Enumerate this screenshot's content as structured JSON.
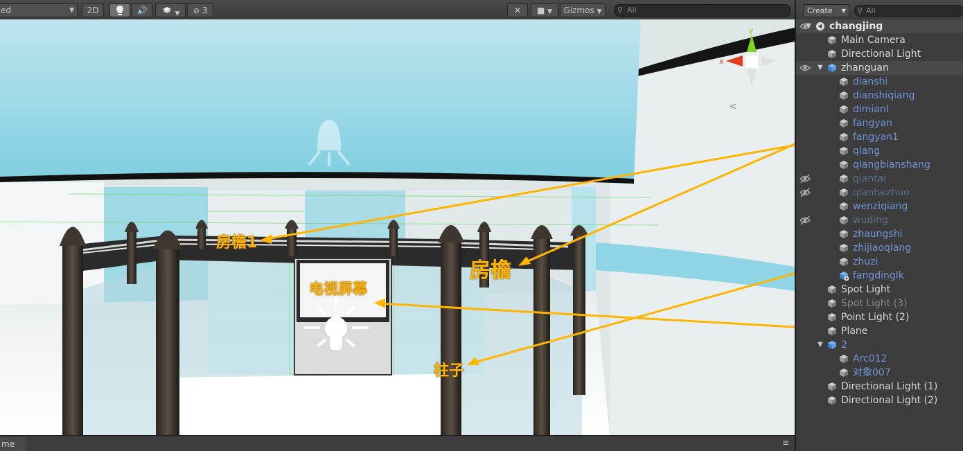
{
  "scene_toolbar": {
    "shading_mode": "ed",
    "mode_2d": "2D",
    "hidden_count": "3",
    "gizmos_label": "Gizmos",
    "search_placeholder": "All"
  },
  "scene_footer": {
    "tab_label": "me",
    "menu_icon": "≡"
  },
  "annotations": {
    "fangyan1": "房檐1",
    "fangyan": "房檐",
    "tv_screen": "电视屏幕",
    "zhuzi": "柱子"
  },
  "annotation_color": "#ffb400",
  "hierarchy": {
    "create_label": "Create",
    "search_placeholder": "All",
    "items": [
      {
        "label": "changjing",
        "style": "bold",
        "icon": "unity-scene-icon"
      },
      {
        "label": "Main Camera",
        "style": "white",
        "icon": "gameobject-icon"
      },
      {
        "label": "Directional Light",
        "style": "white",
        "icon": "gameobject-icon"
      },
      {
        "label": "zhanguan",
        "style": "white",
        "icon": "prefab-icon"
      },
      {
        "label": "dianshi",
        "style": "blue",
        "icon": "gameobject-icon"
      },
      {
        "label": "dianshiqiang",
        "style": "blue",
        "icon": "gameobject-icon"
      },
      {
        "label": "dimianl",
        "style": "blue",
        "icon": "gameobject-icon"
      },
      {
        "label": "fangyan",
        "style": "blue",
        "icon": "gameobject-icon"
      },
      {
        "label": "fangyan1",
        "style": "blue",
        "icon": "gameobject-icon"
      },
      {
        "label": "qiang",
        "style": "blue",
        "icon": "gameobject-icon"
      },
      {
        "label": "qiangbianshang",
        "style": "blue",
        "icon": "gameobject-icon"
      },
      {
        "label": "qiantai",
        "style": "dim",
        "icon": "gameobject-icon"
      },
      {
        "label": "qiantaizhuo",
        "style": "dim",
        "icon": "gameobject-icon"
      },
      {
        "label": "wenziqiang",
        "style": "blue",
        "icon": "gameobject-icon"
      },
      {
        "label": "wuding",
        "style": "dim",
        "icon": "gameobject-icon"
      },
      {
        "label": "zhaungshi",
        "style": "blue",
        "icon": "gameobject-icon"
      },
      {
        "label": "zhijiaoqiang",
        "style": "blue",
        "icon": "gameobject-icon"
      },
      {
        "label": "zhuzi",
        "style": "blue",
        "icon": "gameobject-icon"
      },
      {
        "label": "fangdinglk",
        "style": "blue",
        "icon": "prefab-add-icon"
      },
      {
        "label": "Spot Light",
        "style": "white",
        "icon": "gameobject-icon"
      },
      {
        "label": "Spot Light (3)",
        "style": "gray",
        "icon": "gameobject-icon"
      },
      {
        "label": "Point Light (2)",
        "style": "white",
        "icon": "gameobject-icon"
      },
      {
        "label": "Plane",
        "style": "white",
        "icon": "gameobject-icon"
      },
      {
        "label": "2",
        "style": "blue",
        "icon": "prefab-icon"
      },
      {
        "label": "Arc012",
        "style": "blue",
        "icon": "gameobject-icon"
      },
      {
        "label": "对象007",
        "style": "blue",
        "icon": "gameobject-icon"
      },
      {
        "label": "Directional Light (1)",
        "style": "white",
        "icon": "gameobject-icon"
      },
      {
        "label": "Directional Light (2)",
        "style": "white",
        "icon": "gameobject-icon"
      }
    ]
  }
}
